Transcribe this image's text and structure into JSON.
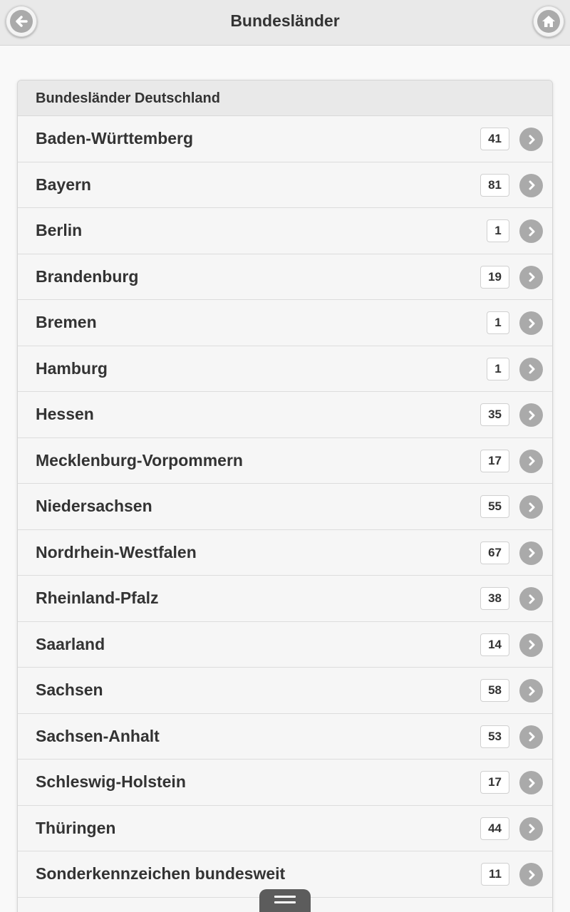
{
  "header": {
    "title": "Bundesländer",
    "back_icon": "arrow-left-icon",
    "home_icon": "home-icon"
  },
  "list": {
    "heading": "Bundesländer Deutschland",
    "items": [
      {
        "label": "Baden-Württemberg",
        "count": "41"
      },
      {
        "label": "Bayern",
        "count": "81"
      },
      {
        "label": "Berlin",
        "count": "1"
      },
      {
        "label": "Brandenburg",
        "count": "19"
      },
      {
        "label": "Bremen",
        "count": "1"
      },
      {
        "label": "Hamburg",
        "count": "1"
      },
      {
        "label": "Hessen",
        "count": "35"
      },
      {
        "label": "Mecklenburg-Vorpommern",
        "count": "17"
      },
      {
        "label": "Niedersachsen",
        "count": "55"
      },
      {
        "label": "Nordrhein-Westfalen",
        "count": "67"
      },
      {
        "label": "Rheinland-Pfalz",
        "count": "38"
      },
      {
        "label": "Saarland",
        "count": "14"
      },
      {
        "label": "Sachsen",
        "count": "58"
      },
      {
        "label": "Sachsen-Anhalt",
        "count": "53"
      },
      {
        "label": "Schleswig-Holstein",
        "count": "17"
      },
      {
        "label": "Thüringen",
        "count": "44"
      },
      {
        "label": "Sonderkennzeichen bundesweit",
        "count": "11"
      }
    ]
  },
  "footer": {
    "menu_icon": "hamburger-menu-icon"
  },
  "colors": {
    "header_bg": "#e9e9e9",
    "icon_gray": "#aaaaaa",
    "menu_tab": "#5c5c5c"
  }
}
